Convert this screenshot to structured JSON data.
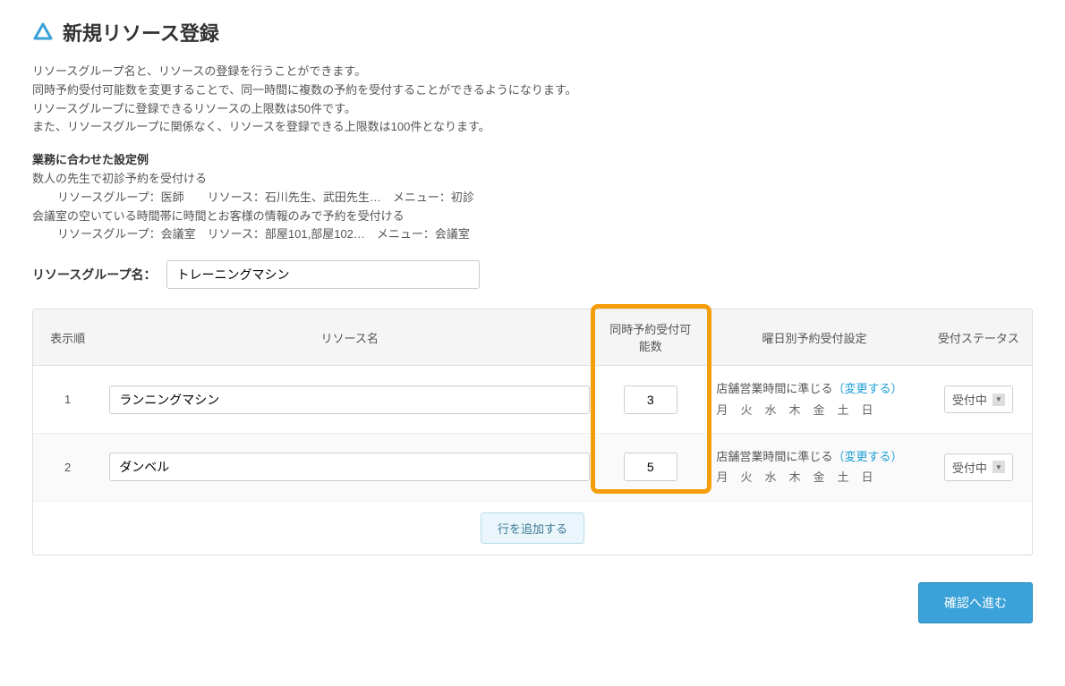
{
  "page_title": "新規リソース登録",
  "description": {
    "line1": "リソースグループ名と、リソースの登録を行うことができます。",
    "line2": "同時予約受付可能数を変更することで、同一時間に複数の予約を受付することができるようになります。",
    "line3": "リソースグループに登録できるリソースの上限数は50件です。",
    "line4": "また、リソースグループに関係なく、リソースを登録できる上限数は100件となります。"
  },
  "example": {
    "title": "業務に合わせた設定例",
    "case1_desc": "数人の先生で初診予約を受付ける",
    "case1_detail": "リソースグループ：医師　　リソース：石川先生、武田先生…　メニュー：初診",
    "case2_desc": "会議室の空いている時間帯に時間とお客様の情報のみで予約を受付ける",
    "case2_detail": "リソースグループ：会議室　リソース：部屋101,部屋102…　メニュー：会議室"
  },
  "group_name": {
    "label": "リソースグループ名：",
    "value": "トレーニングマシン"
  },
  "table": {
    "headers": {
      "order": "表示順",
      "name": "リソース名",
      "concurrent": "同時予約受付可能数",
      "weekday": "曜日別予約受付設定",
      "status": "受付ステータス"
    },
    "weekday_base_text": "店舗営業時間に準じる",
    "weekday_change_link": "（変更する）",
    "days": {
      "mon": "月",
      "tue": "火",
      "wed": "水",
      "thu": "木",
      "fri": "金",
      "sat": "土",
      "sun": "日"
    },
    "rows": [
      {
        "order": "1",
        "name": "ランニングマシン",
        "concurrent": "3",
        "status": "受付中"
      },
      {
        "order": "2",
        "name": "ダンベル",
        "concurrent": "5",
        "status": "受付中"
      }
    ],
    "add_row_label": "行を追加する"
  },
  "submit_label": "確認へ進む"
}
